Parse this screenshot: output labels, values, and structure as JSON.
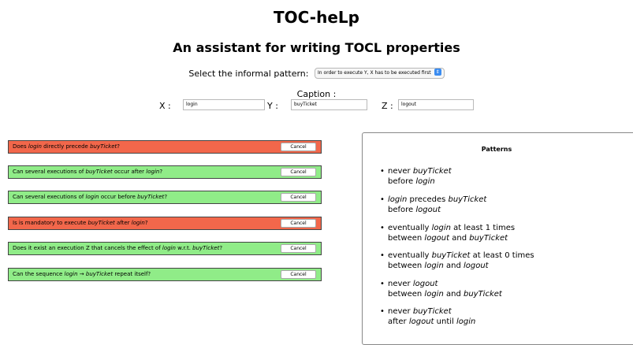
{
  "header": {
    "title": "TOC-heLp",
    "subtitle": "An assistant for writing TOCL properties"
  },
  "pattern_select": {
    "label": "Select the informal pattern:",
    "value": "In order to execute Y, X has to be executed first"
  },
  "caption": {
    "label": "Caption :",
    "x_label": "X :",
    "x_value": "login",
    "y_label": "Y :",
    "y_value": "buyTicket",
    "z_label": "Z :",
    "z_value": "logout"
  },
  "questions": [
    {
      "status": "red",
      "parts": [
        "Does ",
        "login",
        " directly precede ",
        "buyTicket",
        "?"
      ],
      "cancel": "Cancel"
    },
    {
      "status": "green",
      "parts": [
        "Can several executions of ",
        "buyTicket",
        " occur after ",
        "login",
        "?"
      ],
      "cancel": "Cancel"
    },
    {
      "status": "green",
      "parts": [
        "Can several executions of ",
        "login",
        " occur before ",
        "buyTicket",
        "?"
      ],
      "cancel": "Cancel"
    },
    {
      "status": "red",
      "parts": [
        "Is is mandatory to execute ",
        "buyTicket",
        " after ",
        "login",
        "?"
      ],
      "cancel": "Cancel"
    },
    {
      "status": "green",
      "parts": [
        "Does it exist an execution Z that cancels the effect of ",
        "login",
        " w.r.t. ",
        "buyTicket",
        "?"
      ],
      "cancel": "Cancel"
    },
    {
      "status": "green",
      "parts": [
        "Can the sequence ",
        "login",
        " → ",
        "buyTicket",
        " repeat itself?"
      ],
      "cancel": "Cancel"
    }
  ],
  "colors": {
    "red": "#f2674b",
    "green": "#90ec88",
    "select_arrow": "#3b8cf0"
  },
  "patterns": {
    "title": "Patterns",
    "items": [
      {
        "line1": [
          "never ",
          "buyTicket"
        ],
        "line2": [
          "before ",
          "login"
        ]
      },
      {
        "line1": [
          "",
          "login",
          " precedes ",
          "buyTicket"
        ],
        "line2": [
          "before ",
          "logout"
        ]
      },
      {
        "line1": [
          "eventually ",
          "login",
          " at least 1 times"
        ],
        "line2": [
          "between ",
          "logout",
          " and ",
          "buyTicket"
        ]
      },
      {
        "line1": [
          "eventually ",
          "buyTicket",
          " at least 0 times"
        ],
        "line2": [
          "between ",
          "login",
          " and ",
          "logout"
        ]
      },
      {
        "line1": [
          "never ",
          "logout"
        ],
        "line2": [
          "between ",
          "login",
          " and ",
          "buyTicket"
        ]
      },
      {
        "line1": [
          "never ",
          "buyTicket"
        ],
        "line2": [
          "after ",
          "logout",
          " until ",
          "login"
        ]
      }
    ]
  }
}
